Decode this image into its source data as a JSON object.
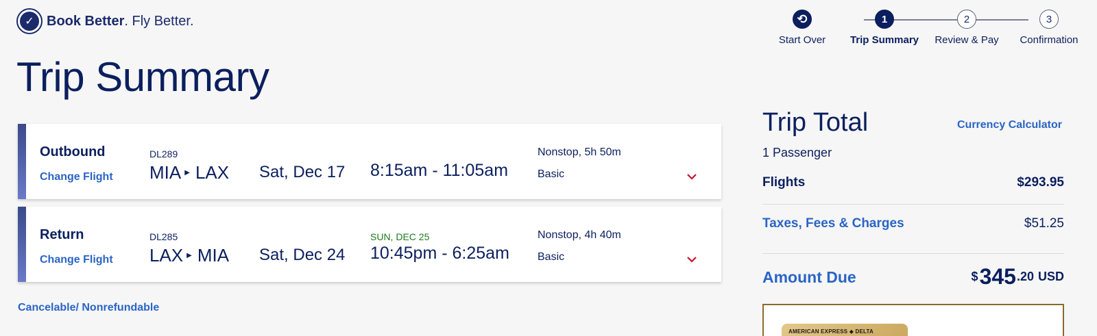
{
  "header": {
    "logo_bold": "Book Better",
    "logo_rest": ". Fly Better."
  },
  "stepper": {
    "steps": [
      {
        "icon": "⟲",
        "label": "Start Over",
        "state": "startover"
      },
      {
        "icon": "1",
        "label": "Trip Summary",
        "state": "active"
      },
      {
        "icon": "2",
        "label": "Review & Pay",
        "state": "pending"
      },
      {
        "icon": "3",
        "label": "Confirmation",
        "state": "pending"
      }
    ]
  },
  "page": {
    "title": "Trip Summary"
  },
  "flights": [
    {
      "direction": "Outbound",
      "change_label": "Change Flight",
      "flight_number": "DL289",
      "origin": "MIA",
      "destination": "LAX",
      "date": "Sat, Dec 17",
      "arrival_note": "",
      "time": "8:15am - 11:05am",
      "stops": "Nonstop, 5h 50m",
      "fare_class": "Basic"
    },
    {
      "direction": "Return",
      "change_label": "Change Flight",
      "flight_number": "DL285",
      "origin": "LAX",
      "destination": "MIA",
      "date": "Sat, Dec 24",
      "arrival_note": "SUN, DEC 25",
      "time": "10:45pm - 6:25am",
      "stops": "Nonstop, 4h 40m",
      "fare_class": "Basic"
    }
  ],
  "fare_note": "Cancelable/ Nonrefundable",
  "summary": {
    "title": "Trip Total",
    "currency_link": "Currency Calculator",
    "passengers": "1 Passenger",
    "flights_label": "Flights",
    "flights_amount": "$293.95",
    "taxes_label": "Taxes, Fees & Charges",
    "taxes_amount": "$51.25",
    "due_label": "Amount Due",
    "due_currency_symbol": "$",
    "due_whole": "345",
    "due_cents": ".20",
    "due_code": "USD"
  },
  "promo": {
    "card_text": "AMERICAN EXPRESS   ◆ DELTA"
  },
  "colors": {
    "navy": "#0b1f5e",
    "link_blue": "#2a64c5",
    "red_chevron": "#c8102e",
    "green_note": "#1e7a1e"
  }
}
